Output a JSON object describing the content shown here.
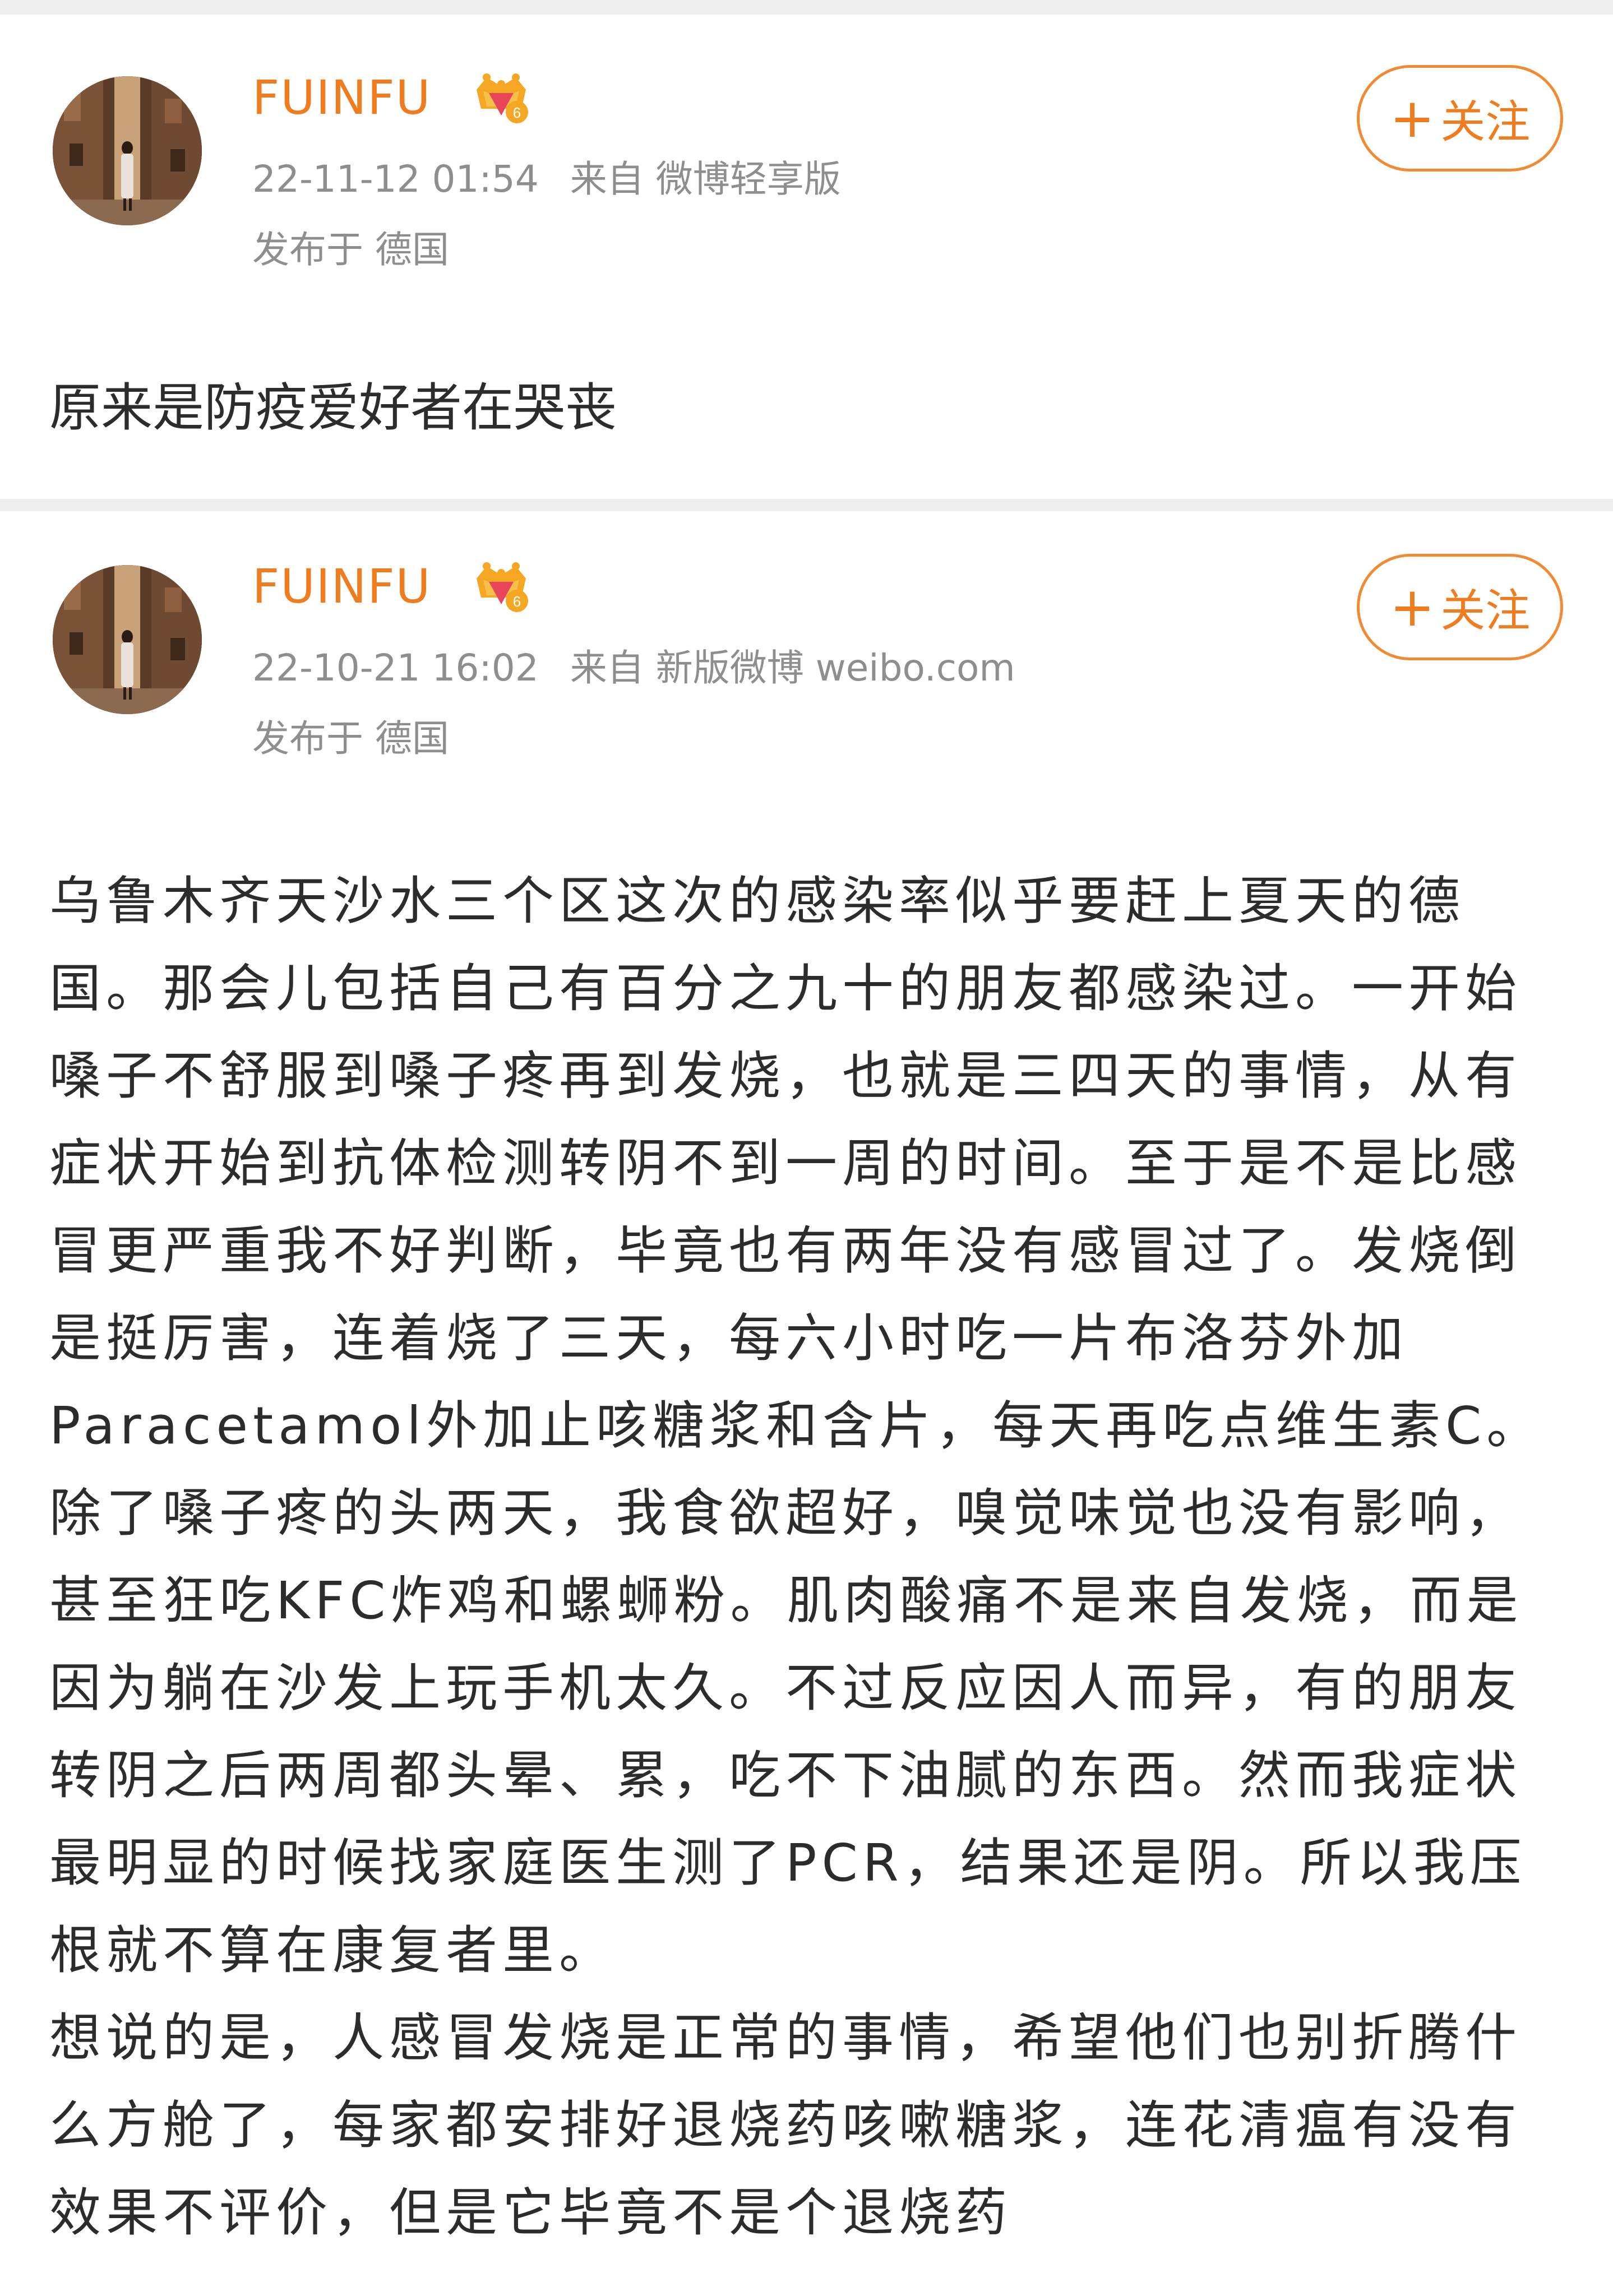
{
  "posts": [
    {
      "username": "FUINFU",
      "timestamp": "22-11-12 01:54",
      "source": "来自 微博轻享版",
      "location": "发布于 德国",
      "follow_label": "关注",
      "text": "原来是防疫爱好者在哭丧"
    },
    {
      "username": "FUINFU",
      "timestamp": "22-10-21 16:02",
      "source": "来自 新版微博 weibo.com",
      "location": "发布于 德国",
      "follow_label": "关注",
      "paragraphs": [
        "乌鲁木齐天沙水三个区这次的感染率似乎要赶上夏天的德国。那会儿包括自己有百分之九十的朋友都感染过。一开始嗓子不舒服到嗓子疼再到发烧，也就是三四天的事情，从有症状开始到抗体检测转阴不到一周的时间。至于是不是比感冒更严重我不好判断，毕竟也有两年没有感冒过了。发烧倒是挺厉害，连着烧了三天，每六小时吃一片布洛芬外加Paracetamol外加止咳糖浆和含片，每天再吃点维生素C。除了嗓子疼的头两天，我食欲超好，嗅觉味觉也没有影响，甚至狂吃KFC炸鸡和螺蛳粉。肌肉酸痛不是来自发烧，而是因为躺在沙发上玩手机太久。不过反应因人而异，有的朋友转阴之后两周都头晕、累，吃不下油腻的东西。然而我症状最明显的时候找家庭医生测了PCR，结果还是阴。所以我压根就不算在康复者里。",
        "想说的是，人感冒发烧是正常的事情，希望他们也别折腾什么方舱了，每家都安排好退烧药咳嗽糖浆，连花清瘟有没有效果不评价，但是它毕竟不是个退烧药"
      ]
    }
  ],
  "colors": {
    "accent": "#f07c20",
    "meta_gray": "#8e8e8e",
    "divider": "#efefef",
    "text": "#2c2c2c"
  },
  "icons": [
    "avatar-photo",
    "vip-crown-icon",
    "plus-icon"
  ]
}
